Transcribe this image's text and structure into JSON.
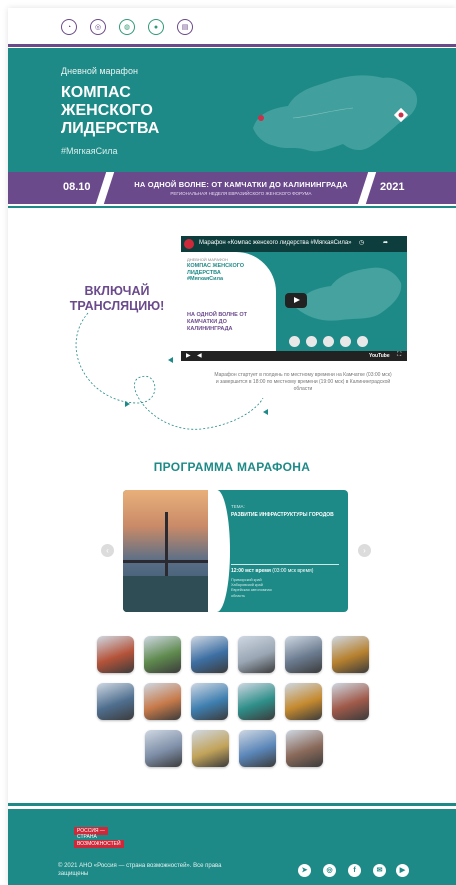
{
  "header": {
    "partners": [
      "partner-logo-1",
      "partner-logo-2",
      "partner-logo-3",
      "partner-logo-4",
      "partner-logo-5"
    ]
  },
  "hero": {
    "subtitle": "Дневной марафон",
    "title": "КОМПАС ЖЕНСКОГО ЛИДЕРСТВА",
    "hashtag": "#МягкаяСила"
  },
  "strip": {
    "date": "08.10",
    "headline": "НА ОДНОЙ ВОЛНЕ: ОТ КАМЧАТКИ ДО КАЛИНИНГРАДА",
    "small": "РЕГИОНАЛЬНАЯ НЕДЕЛЯ ЕВРАЗИЙСКОГО ЖЕНСКОГО ФОРУМА",
    "year": "2021"
  },
  "broadcast": {
    "cta": "ВКЛЮЧАЙ ТРАНСЛЯЦИЮ!",
    "video_title": "Марафон «Компас женского лидерства #МягкаяСила»",
    "video_panel_sub": "ДНЕВНОЙ МАРАФОН",
    "video_panel_title": "КОМПАС ЖЕНСКОГО ЛИДЕРСТВА #МягкаяСила",
    "video_panel_wave": "НА ОДНОЙ ВОЛНЕ ОТ КАМЧАТКИ ДО КАЛИНИНГРАДА",
    "caption": "Марафон стартует в полдень по местному времени на Камчатке (03:00 мск) и завершится в 18:00 по местному времени (19:00 мск) в Калининградской области"
  },
  "program": {
    "title": "ПРОГРАММА МАРАФОНА",
    "card_label": "ТЕМА:",
    "card_topic": "РАЗВИТИЕ ИНФРАСТРУКТУРЫ ГОРОДОВ",
    "card_time": "12:00 мст время",
    "card_time_note": "(03:00 мск время)",
    "regions": [
      "Приморский край",
      "Хабаровский край",
      "Еврейская автономная",
      "область"
    ]
  },
  "thumb_colors": [
    [
      "#b5533a",
      "#5f8a4e",
      "#3d6fa3",
      "#9aa6b4",
      "#6b7b8f",
      "#b7812f"
    ],
    [
      "#4f6f8f",
      "#c77a4a",
      "#3f7fb0",
      "#2f8f8a",
      "#c58a2f",
      "#a05a4a"
    ],
    [
      "#7f8fa8",
      "#c2a35a",
      "#5a86b8",
      "#8a6a5a"
    ]
  ],
  "footer": {
    "logo_line1": "РОССИЯ —",
    "logo_line2": "СТРАНА",
    "logo_line3": "ВОЗМОЖНОСТЕЙ",
    "copyright": "© 2021 АНО «Россия — страна возможностей». Все права защищены",
    "social": [
      {
        "icon": "telegram-icon",
        "glyph": "➤"
      },
      {
        "icon": "odnoklassniki-icon",
        "glyph": "◎"
      },
      {
        "icon": "facebook-icon",
        "glyph": "f"
      },
      {
        "icon": "vk-icon",
        "glyph": "✉"
      },
      {
        "icon": "youtube-icon",
        "glyph": "▶"
      }
    ]
  },
  "colors": {
    "teal": "#1e8a87",
    "purple": "#6b4a8c"
  }
}
